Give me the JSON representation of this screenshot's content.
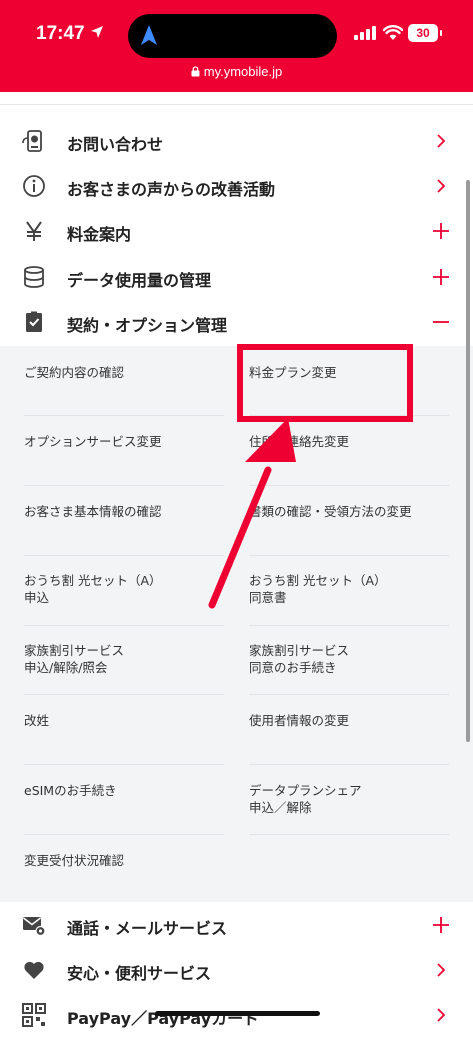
{
  "status_bar": {
    "time": "17:47",
    "battery": "30",
    "url": "my.ymobile.jp",
    "background_color": "#ee0033"
  },
  "menu": {
    "items": [
      {
        "label": "お問い合わせ",
        "icon": "support-phone-icon",
        "control": "chevron-right-icon"
      },
      {
        "label": "お客さまの声からの改善活動",
        "icon": "info-circle-icon",
        "control": "chevron-right-icon"
      },
      {
        "label": "料金案内",
        "icon": "yen-icon",
        "control": "plus-icon"
      },
      {
        "label": "データ使用量の管理",
        "icon": "database-icon",
        "control": "plus-icon"
      },
      {
        "label": "契約・オプション管理",
        "icon": "contract-check-icon",
        "control": "minus-icon"
      }
    ],
    "expanded_items": [
      {
        "label": "ご契約内容の確認",
        "line2": ""
      },
      {
        "label": "料金プラン変更",
        "line2": ""
      },
      {
        "label": "オプションサービス変更",
        "line2": ""
      },
      {
        "label": "住所・連絡先変更",
        "line2": ""
      },
      {
        "label": "お客さま基本情報の確認",
        "line2": ""
      },
      {
        "label": "書類の確認・受領方法の変更",
        "line2": ""
      },
      {
        "label": "おうち割 光セット（A）",
        "line2": "申込"
      },
      {
        "label": "おうち割 光セット（A）",
        "line2": "同意書"
      },
      {
        "label": "家族割引サービス",
        "line2": "申込/解除/照会"
      },
      {
        "label": "家族割引サービス",
        "line2": "同意のお手続き"
      },
      {
        "label": "改姓",
        "line2": ""
      },
      {
        "label": "使用者情報の変更",
        "line2": ""
      },
      {
        "label": "eSIMのお手続き",
        "line2": ""
      },
      {
        "label": "データプランシェア",
        "line2": "申込／解除"
      },
      {
        "label": "変更受付状況確認",
        "line2": ""
      }
    ],
    "bottom_items": [
      {
        "label": "通話・メールサービス",
        "icon": "mail-gear-icon",
        "control": "plus-icon"
      },
      {
        "label": "安心・便利サービス",
        "icon": "heart-icon",
        "control": "chevron-right-icon"
      },
      {
        "label": "PayPay／PayPayカード",
        "icon": "qr-code-icon",
        "control": "chevron-right-icon"
      }
    ]
  },
  "colors": {
    "accent": "#ee0033",
    "submenu_bg": "#f3f4f6"
  }
}
